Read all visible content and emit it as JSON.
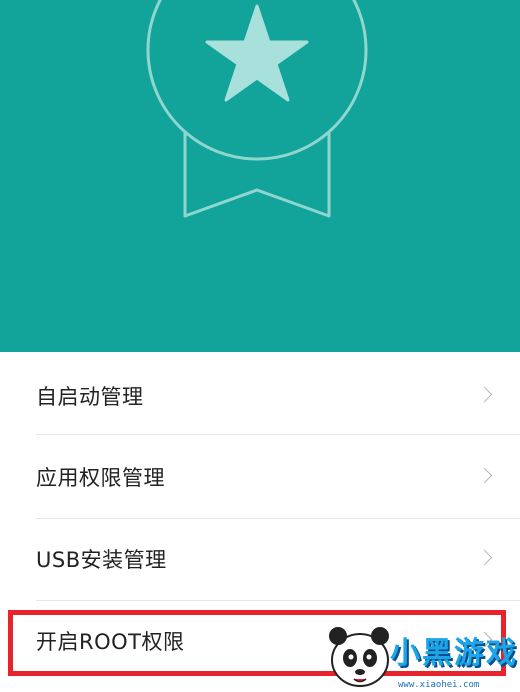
{
  "colors": {
    "header_bg": "#12a39a",
    "badge_stroke": "#8fd6cf",
    "star_fill": "#a8e1dc",
    "highlight_border": "#e8232b"
  },
  "header": {
    "icon": "award-badge-icon"
  },
  "menu": {
    "items": [
      {
        "label": "自启动管理",
        "icon": "chevron-right-icon"
      },
      {
        "label": "应用权限管理",
        "icon": "chevron-right-icon"
      },
      {
        "label": "USB安装管理",
        "icon": "chevron-right-icon"
      },
      {
        "label": "开启ROOT权限",
        "icon": "chevron-right-icon"
      }
    ]
  },
  "watermark": {
    "title": "小黑游戏",
    "url": "www.xiaohei.com",
    "icon": "panda-mascot-icon"
  }
}
